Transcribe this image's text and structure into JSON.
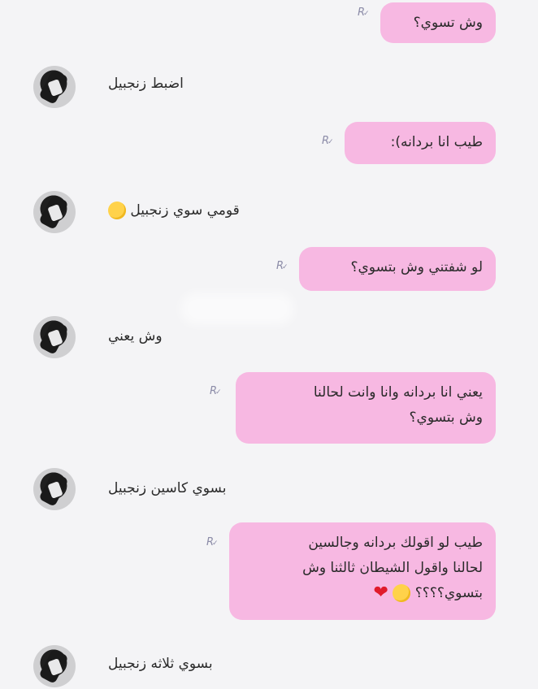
{
  "messages": [
    {
      "type": "outgoing",
      "lines": [
        "وش تسوي؟"
      ]
    },
    {
      "type": "incoming",
      "text": "اضبط زنجبيل"
    },
    {
      "type": "outgoing",
      "lines": [
        "طيب انا بردانه):"
      ]
    },
    {
      "type": "incoming",
      "text": "قومي سوي زنجبيل",
      "emoji": "smiling-face-with-sunglasses-icon"
    },
    {
      "type": "outgoing",
      "lines": [
        "لو شفتني وش بتسوي؟"
      ]
    },
    {
      "type": "incoming",
      "text": "وش يعني"
    },
    {
      "type": "outgoing",
      "lines": [
        "يعني انا بردانه وانا وانت لحالنا",
        "وش بتسوي؟"
      ]
    },
    {
      "type": "incoming",
      "text": "بسوي كاسين زنجبيل"
    },
    {
      "type": "outgoing",
      "lines": [
        "طيب لو اقولك بردانه وجالسين",
        "لحالنا واقول الشيطان ثالثنا وش",
        "بتسوي؟؟؟؟"
      ],
      "emoji": [
        "flushed-face-icon",
        "red-heart-icon"
      ]
    },
    {
      "type": "incoming",
      "text": "بسوي ثلاثه زنجبيل"
    }
  ],
  "receipt_mark": "R",
  "colors": {
    "bubble_outgoing": "#f7b8e2",
    "background": "#f4f4f6",
    "text": "#2a2a2a",
    "receipt": "#8c8ca8"
  }
}
